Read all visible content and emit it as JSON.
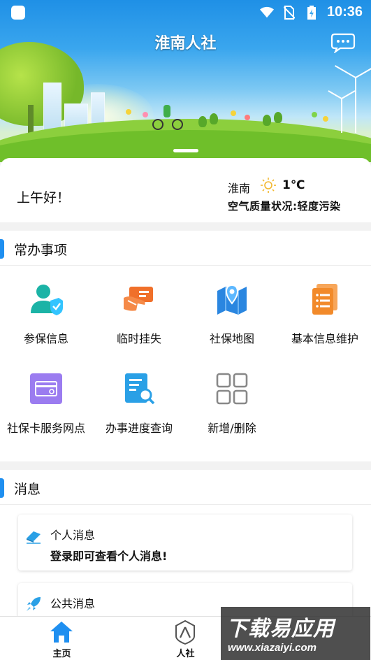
{
  "status_bar": {
    "time": "10:36"
  },
  "header": {
    "title": "淮南人社"
  },
  "greeting": {
    "text": "上午好！",
    "city": "淮南",
    "temperature": "1℃",
    "air_quality": "空气质量状况:轻度污染"
  },
  "common_tasks": {
    "title": "常办事项",
    "items": [
      {
        "label": "参保信息",
        "icon": "user-shield-icon",
        "color": "#1bb3a6"
      },
      {
        "label": "临时挂失",
        "icon": "card-hand-icon",
        "color": "#f0702a"
      },
      {
        "label": "社保地图",
        "icon": "map-pin-icon",
        "color": "#2a86e0"
      },
      {
        "label": "基本信息维护",
        "icon": "document-list-icon",
        "color": "#f28a2a"
      },
      {
        "label": "社保卡服务网点",
        "icon": "card-service-icon",
        "color": "#9b7cf0"
      },
      {
        "label": "办事进度查询",
        "icon": "document-search-icon",
        "color": "#2aa0e6"
      },
      {
        "label": "新增/删除",
        "icon": "grid-icon",
        "color": "#888888"
      }
    ]
  },
  "messages": {
    "title": "消息",
    "items": [
      {
        "title": "个人消息",
        "body": "登录即可查看个人消息!",
        "icon": "eraser-icon"
      },
      {
        "title": "公共消息",
        "body": "",
        "icon": "rocket-icon"
      }
    ]
  },
  "bottom_nav": {
    "items": [
      {
        "label": "主页",
        "icon": "home-icon",
        "active": true
      },
      {
        "label": "人社",
        "icon": "person-shield-icon",
        "active": false
      }
    ]
  },
  "watermark": {
    "main": "下载易应用",
    "url": "www.xiazaiyi.com"
  },
  "colors": {
    "accent": "#1f8ff0",
    "text": "#111111"
  }
}
